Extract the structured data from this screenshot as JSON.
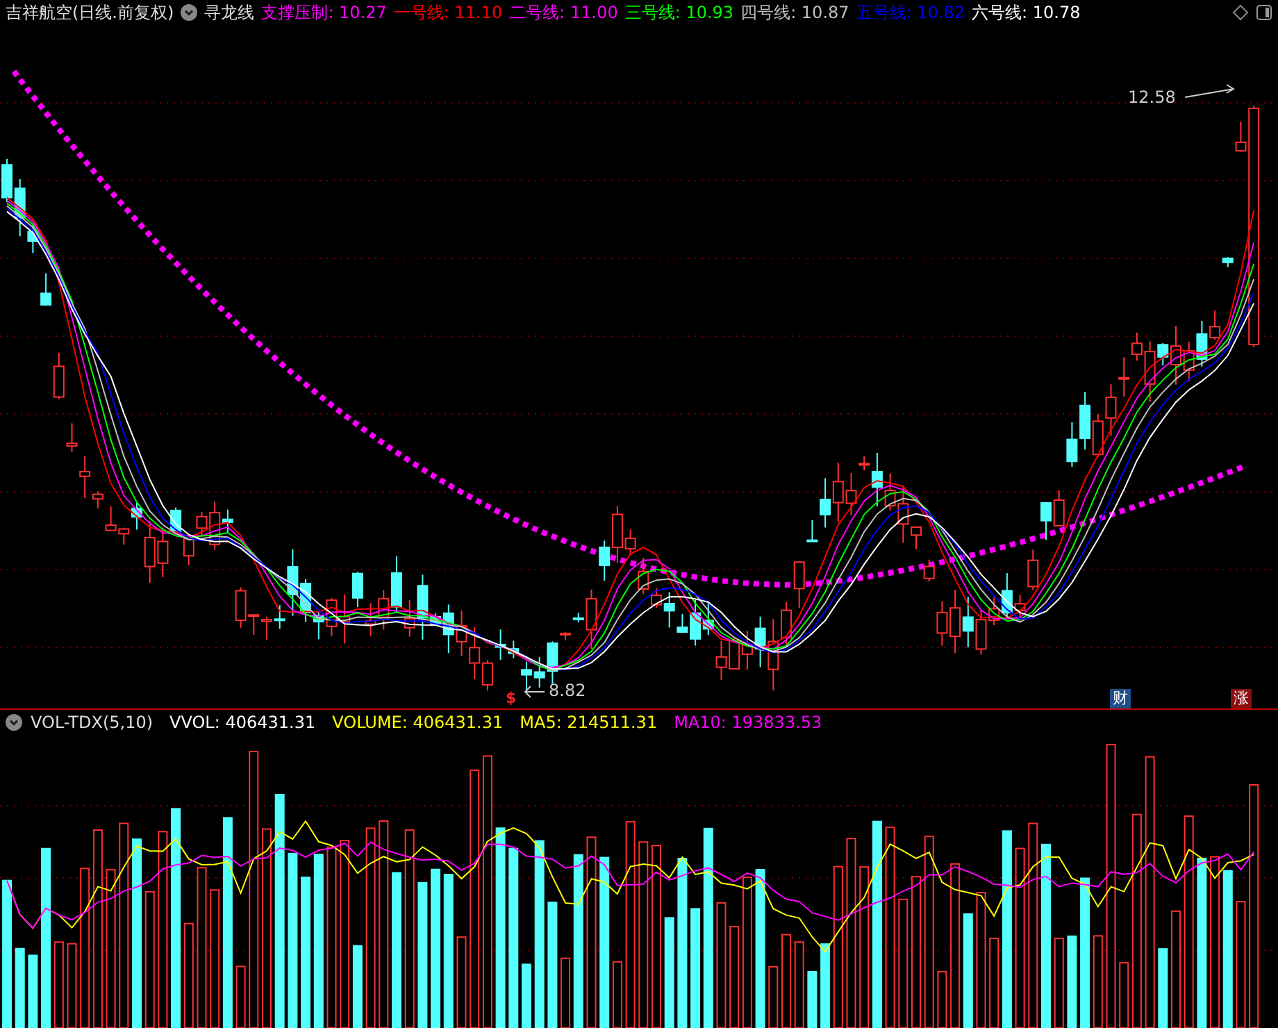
{
  "header": {
    "title": "吉祥航空(日线.前复权)",
    "indicator": "寻龙线",
    "legend": [
      {
        "label": "支撑压制:",
        "value": "10.27",
        "color": "#ff00ff"
      },
      {
        "label": "一号线:",
        "value": "11.10",
        "color": "#ff0000"
      },
      {
        "label": "二号线:",
        "value": "11.00",
        "color": "#ff00ff"
      },
      {
        "label": "三号线:",
        "value": "10.93",
        "color": "#00ff00"
      },
      {
        "label": "四号线:",
        "value": "10.87",
        "color": "#c0c0c0"
      },
      {
        "label": "五号线:",
        "value": "10.82",
        "color": "#0000ff"
      },
      {
        "label": "六号线:",
        "value": "10.78",
        "color": "#ffffff"
      }
    ]
  },
  "price_chart": {
    "high_label": "12.58",
    "low_label": "8.82",
    "markers": [
      {
        "text": "$",
        "kind": "signal"
      },
      {
        "text": "财",
        "kind": "finance"
      },
      {
        "text": "涨",
        "kind": "rise"
      }
    ]
  },
  "volume_panel": {
    "indicator": "VOL-TDX(5,10)",
    "readings": [
      {
        "text": "VVOL: 406431.31",
        "color": "#ffffff"
      },
      {
        "text": "VOLUME: 406431.31",
        "color": "#ffff00"
      },
      {
        "text": "MA5: 214511.31",
        "color": "#ffff00"
      },
      {
        "text": "MA10: 193833.53",
        "color": "#ff00ff"
      }
    ]
  }
}
